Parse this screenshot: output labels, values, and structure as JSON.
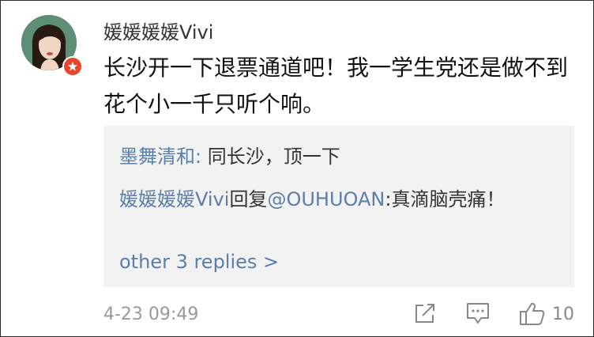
{
  "comment": {
    "username": "媛媛媛媛Vivi",
    "text": "长沙开一下退票通道吧！我一学生党还是做不到花个小一千只听个响。",
    "timestamp": "4-23 09:49",
    "like_count": "10"
  },
  "replies": [
    {
      "name": "墨舞清和:",
      "text": " 同长沙，顶一下"
    },
    {
      "name": "媛媛媛媛Vivi",
      "reply_word": "回复",
      "target": "@OUHUOAN",
      "text": ":真滴脑壳痛！"
    }
  ],
  "more_replies": "other 3 replies >",
  "icons": {
    "share": "share-icon",
    "comment": "comment-icon",
    "like": "thumbs-up-icon",
    "badge": "verified-star-icon"
  },
  "colors": {
    "link": "#5b7fa8",
    "badge": "#e8452c",
    "reply_bg": "#f2f2f2"
  }
}
